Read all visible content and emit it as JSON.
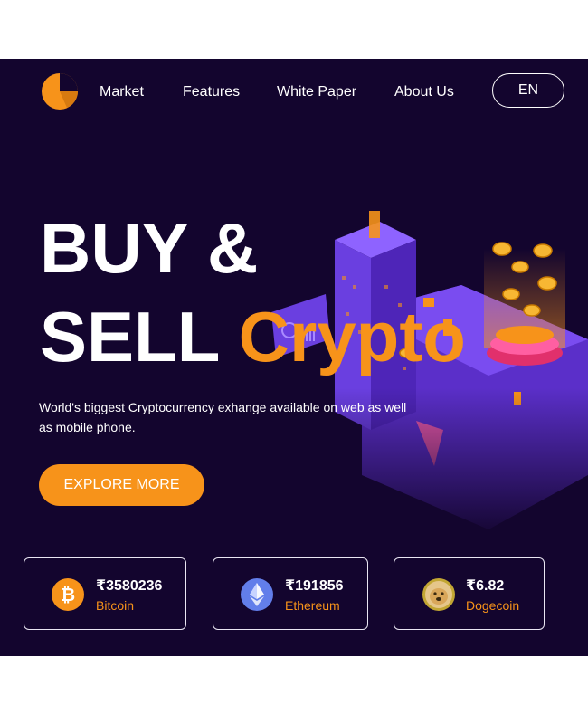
{
  "nav": {
    "links": [
      "Market",
      "Features",
      "White Paper",
      "About Us"
    ],
    "language": "EN"
  },
  "hero": {
    "headline_line1": "BUY &",
    "headline_line2_white": "SELL",
    "headline_line2_accent": "Crypto",
    "subtitle": "World's biggest Cryptocurrency exhange available on web as well as mobile phone.",
    "cta_label": "EXPLORE MORE"
  },
  "coins": [
    {
      "price": "₹3580236",
      "name": "Bitcoin",
      "icon": "bitcoin-icon"
    },
    {
      "price": "₹191856",
      "name": "Ethereum",
      "icon": "ethereum-icon"
    },
    {
      "price": "₹6.82",
      "name": "Dogecoin",
      "icon": "dogecoin-icon"
    }
  ],
  "colors": {
    "background": "#13052e",
    "accent": "#f7931a",
    "text": "#ffffff",
    "purple": "#6a3fe0"
  }
}
